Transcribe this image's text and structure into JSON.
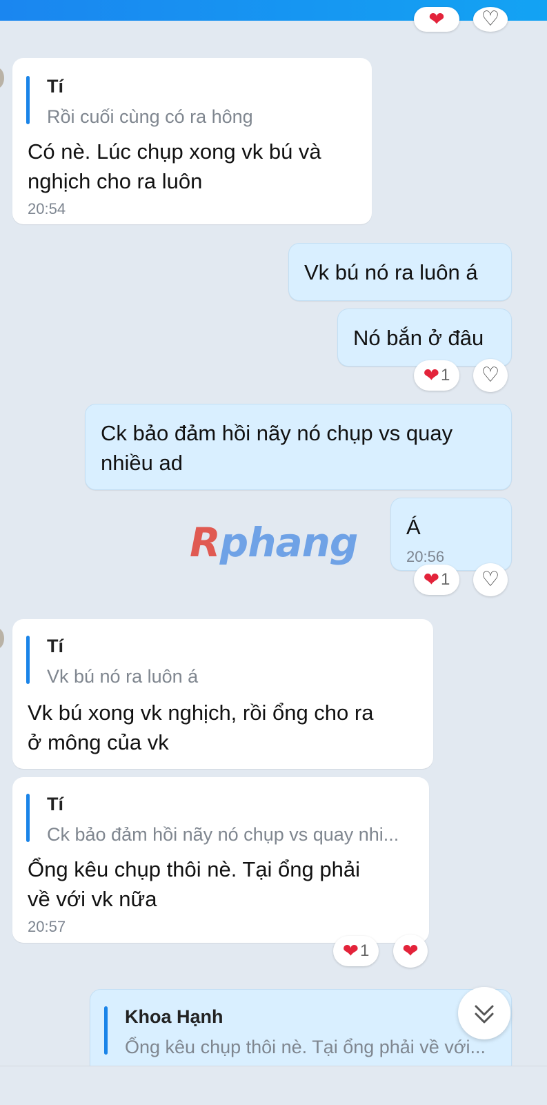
{
  "messages": [
    {
      "quote_name": "Tí",
      "quote_text": "Rồi cuối cùng có ra hông",
      "line1": "Có nè. Lúc chụp xong vk bú và",
      "line2": "nghịch cho ra luôn",
      "time": "20:54"
    },
    {
      "text": "Vk bú nó ra luôn á"
    },
    {
      "text": "Nó bắn ở đâu",
      "reaction_count": "1"
    },
    {
      "line1": "Ck bảo đảm hồi nãy nó chụp vs quay",
      "line2": "nhiều ad"
    },
    {
      "text": "Á",
      "time": "20:56",
      "reaction_count": "1"
    },
    {
      "quote_name": "Tí",
      "quote_text": "Vk bú nó ra luôn á",
      "line1": "Vk bú xong vk nghịch, rồi ổng cho ra",
      "line2": "ở mông của vk"
    },
    {
      "quote_name": "Tí",
      "quote_text": "Ck bảo đảm hồi nãy nó chụp vs quay nhi...",
      "line1": "Ổng kêu chụp thôi nè. Tại ổng phải",
      "line2": "về với vk nữa",
      "time": "20:57",
      "reaction_count": "1"
    },
    {
      "quote_name": "Khoa Hạnh",
      "quote_text": "Ổng kêu chụp thôi nè. Tại ổng phải về với..."
    }
  ],
  "watermark": {
    "part1": "R",
    "part2": "phang"
  },
  "icons": {
    "heart_filled": "heart-filled-icon",
    "heart_outline": "heart-outline-icon",
    "scroll_down": "double-chevron-down-icon"
  },
  "colors": {
    "background": "#e2e9f1",
    "incoming": "#ffffff",
    "outgoing": "#d9efff",
    "accent": "#1a84e8",
    "heart": "#e3233a"
  }
}
